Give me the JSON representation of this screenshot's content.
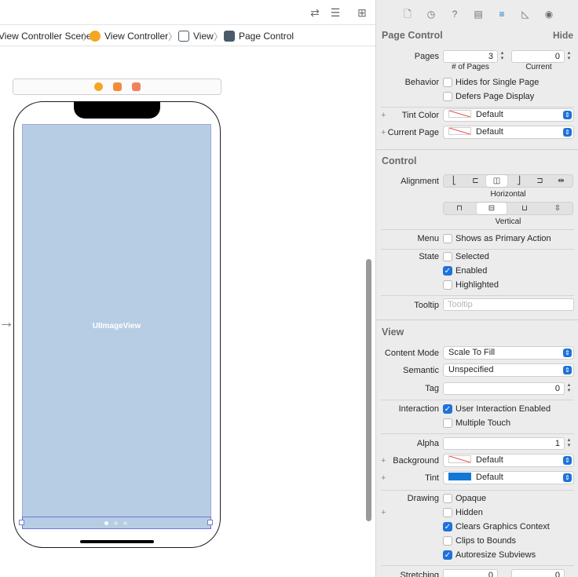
{
  "breadcrumb": [
    {
      "label": "View Controller Scene",
      "icon": "scene-icon"
    },
    {
      "label": "View Controller",
      "icon": "view-controller-icon"
    },
    {
      "label": "View",
      "icon": "view-icon"
    },
    {
      "label": "Page Control",
      "icon": "page-control-icon"
    }
  ],
  "canvas": {
    "imageview_label": "UIImageView",
    "page_control_pages": 3,
    "page_control_current": 0
  },
  "inspector": {
    "page_control": {
      "title": "Page Control",
      "hide_label": "Hide",
      "pages_label": "Pages",
      "pages_value": "3",
      "current_value": "0",
      "pages_sublabel": "# of Pages",
      "current_sublabel": "Current",
      "behavior_label": "Behavior",
      "hides_single_page": "Hides for Single Page",
      "defers_display": "Defers Page Display",
      "tint_color_label": "Tint Color",
      "tint_color_value": "Default",
      "current_page_label": "Current Page",
      "current_page_value": "Default"
    },
    "control": {
      "title": "Control",
      "alignment_label": "Alignment",
      "horizontal_label": "Horizontal",
      "vertical_label": "Vertical",
      "menu_label": "Menu",
      "menu_option": "Shows as Primary Action",
      "state_label": "State",
      "selected": "Selected",
      "enabled": "Enabled",
      "highlighted": "Highlighted",
      "tooltip_label": "Tooltip",
      "tooltip_placeholder": "Tooltip"
    },
    "view": {
      "title": "View",
      "content_mode_label": "Content Mode",
      "content_mode_value": "Scale To Fill",
      "semantic_label": "Semantic",
      "semantic_value": "Unspecified",
      "tag_label": "Tag",
      "tag_value": "0",
      "interaction_label": "Interaction",
      "user_interaction": "User Interaction Enabled",
      "multiple_touch": "Multiple Touch",
      "alpha_label": "Alpha",
      "alpha_value": "1",
      "background_label": "Background",
      "background_value": "Default",
      "tint_label": "Tint",
      "tint_value": "Default",
      "drawing_label": "Drawing",
      "opaque": "Opaque",
      "hidden": "Hidden",
      "clears_graphics": "Clears Graphics Context",
      "clips_bounds": "Clips to Bounds",
      "autoresize": "Autoresize Subviews",
      "stretching_label": "Stretching",
      "stretching_x": "0",
      "stretching_y": "0"
    }
  },
  "colors": {
    "accent": "#1f72d9",
    "imageview_fill": "#b7cde4",
    "tint_swatch": "#1278d4"
  }
}
